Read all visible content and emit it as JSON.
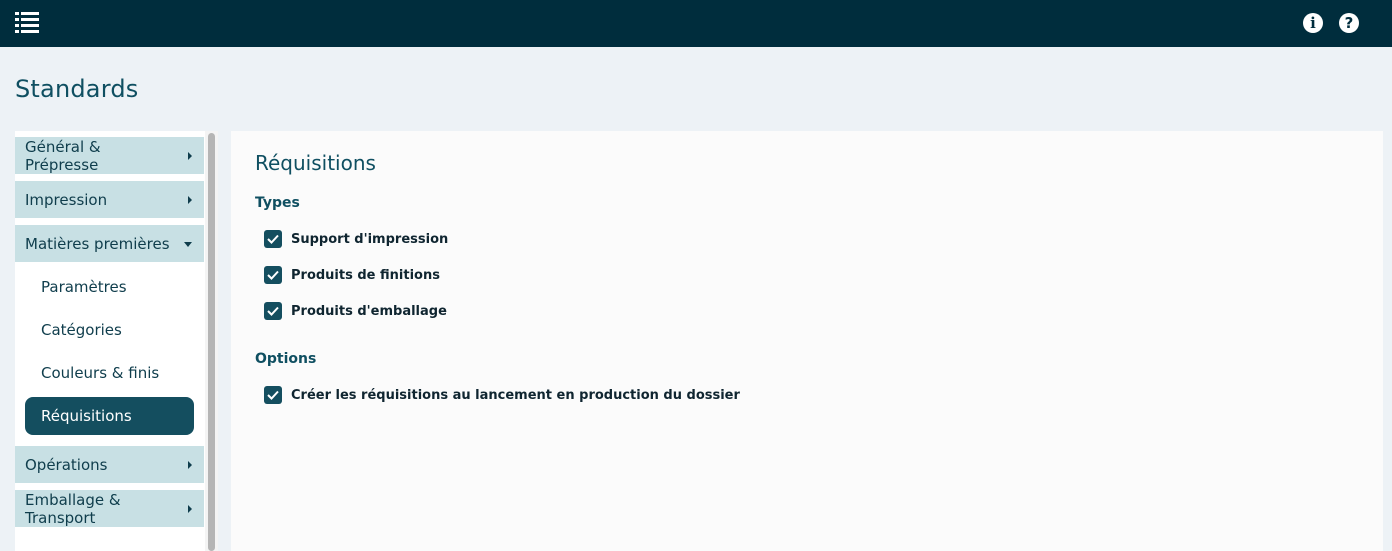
{
  "header": {
    "menu_icon": "hamburger-list-icon",
    "info_icon_glyph": "i",
    "help_icon_glyph": "?"
  },
  "page": {
    "title": "Standards"
  },
  "sidebar": {
    "sections": [
      {
        "label_line1": "Général &",
        "label_line2": "Prépresse",
        "state": "collapsed"
      },
      {
        "label": "Impression",
        "state": "collapsed"
      },
      {
        "label": "Matières premières",
        "state": "expanded"
      },
      {
        "label": "Opérations",
        "state": "collapsed"
      },
      {
        "label_line1": "Emballage &",
        "label_line2": "Transport",
        "state": "collapsed"
      }
    ],
    "sub_items": [
      {
        "label": "Paramètres",
        "active": false
      },
      {
        "label": "Catégories",
        "active": false
      },
      {
        "label": "Couleurs & finis",
        "active": false
      },
      {
        "label": "Réquisitions",
        "active": true
      }
    ]
  },
  "content": {
    "title": "Réquisitions",
    "types_heading": "Types",
    "types": [
      {
        "label": "Support d'impression",
        "checked": true
      },
      {
        "label": "Produits de finitions",
        "checked": true
      },
      {
        "label": "Produits d'emballage",
        "checked": true
      }
    ],
    "options_heading": "Options",
    "options": [
      {
        "label": "Créer les réquisitions au lancement en production du dossier",
        "checked": true
      }
    ]
  },
  "colors": {
    "topbar": "#002d3d",
    "section_bg": "#c8e0e4",
    "active_item": "#144e5f",
    "page_bg": "#edf2f6"
  }
}
